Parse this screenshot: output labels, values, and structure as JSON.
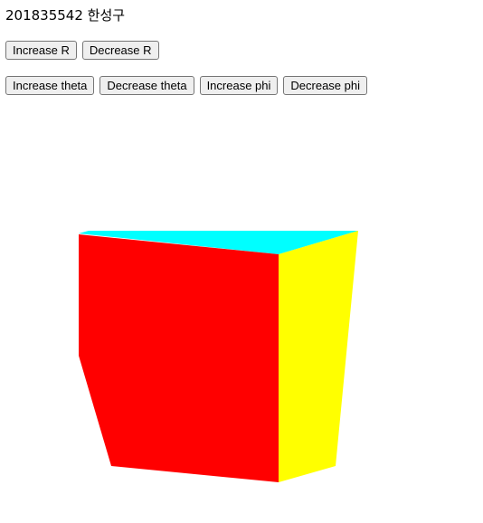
{
  "header": {
    "student_id_name": "201835542 한성구"
  },
  "controls": {
    "radius_buttons": [
      {
        "label": "Increase R"
      },
      {
        "label": "Decrease R"
      }
    ],
    "angle_buttons": [
      {
        "label": "Increase theta"
      },
      {
        "label": "Decrease theta"
      },
      {
        "label": "Increase phi"
      },
      {
        "label": "Decrease phi"
      }
    ]
  },
  "scene": {
    "faces": [
      {
        "name": "top-face",
        "color": "#00ffff"
      },
      {
        "name": "front-face",
        "color": "#ff0000"
      },
      {
        "name": "side-face",
        "color": "#ffff00"
      }
    ]
  }
}
